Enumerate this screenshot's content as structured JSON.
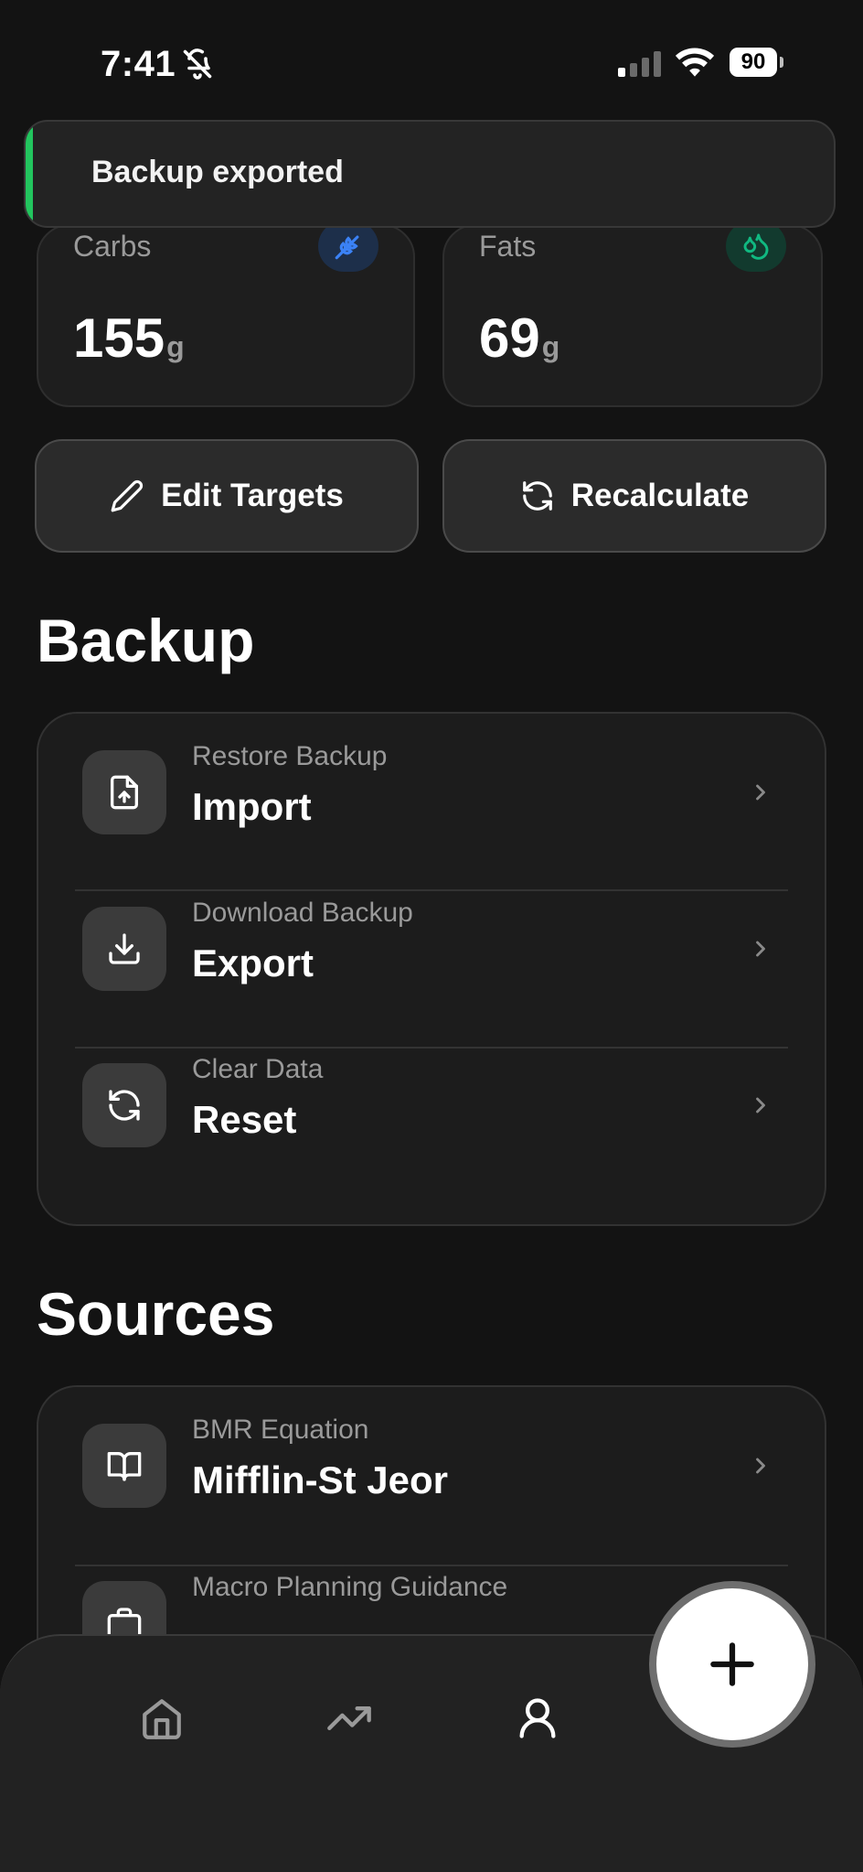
{
  "status_bar": {
    "time": "7:41",
    "battery": "90"
  },
  "toast": {
    "message": "Backup exported"
  },
  "macros": {
    "carbs": {
      "label": "Carbs",
      "value": "155",
      "unit": "g"
    },
    "fats": {
      "label": "Fats",
      "value": "69",
      "unit": "g"
    }
  },
  "actions": {
    "edit_targets": "Edit Targets",
    "recalculate": "Recalculate"
  },
  "backup": {
    "title": "Backup",
    "items": [
      {
        "subtitle": "Restore Backup",
        "title": "Import",
        "icon": "file-upload-icon"
      },
      {
        "subtitle": "Download Backup",
        "title": "Export",
        "icon": "download-icon"
      },
      {
        "subtitle": "Clear Data",
        "title": "Reset",
        "icon": "refresh-icon"
      }
    ]
  },
  "sources": {
    "title": "Sources",
    "items": [
      {
        "subtitle": "BMR Equation",
        "title": "Mifflin-St Jeor",
        "icon": "book-icon"
      },
      {
        "subtitle": "Macro Planning Guidance",
        "title": "",
        "icon": "briefcase-icon"
      }
    ]
  },
  "colors": {
    "accent_green": "#22c55e",
    "carbs_blue": "#3b82f6",
    "fats_green": "#10b981"
  }
}
